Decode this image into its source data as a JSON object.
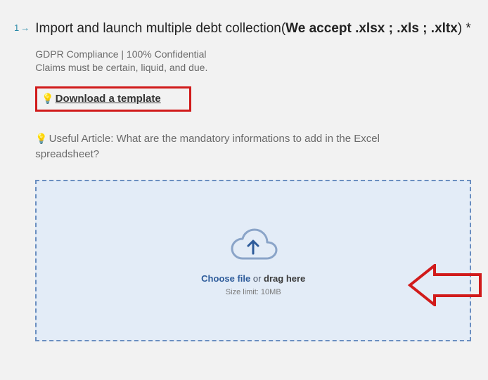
{
  "question": {
    "number": "1",
    "heading_prefix": "Import and launch multiple debt collection(",
    "heading_bold": "We accept .xlsx ; .xls ; .xltx",
    "heading_suffix": ")",
    "required_mark": "*"
  },
  "gdpr_line1": "GDPR Compliance | 100% Confidential",
  "gdpr_line2": "Claims must be certain, liquid, and due.",
  "template_link": "Download a template",
  "useful_article_prefix": "Useful Article: ",
  "useful_article_text": "What are the mandatory informations to add in the Excel spreadsheet?",
  "dropzone": {
    "choose": "Choose file",
    "or": " or ",
    "drag": "drag here",
    "size_limit": "Size limit: 10MB"
  }
}
